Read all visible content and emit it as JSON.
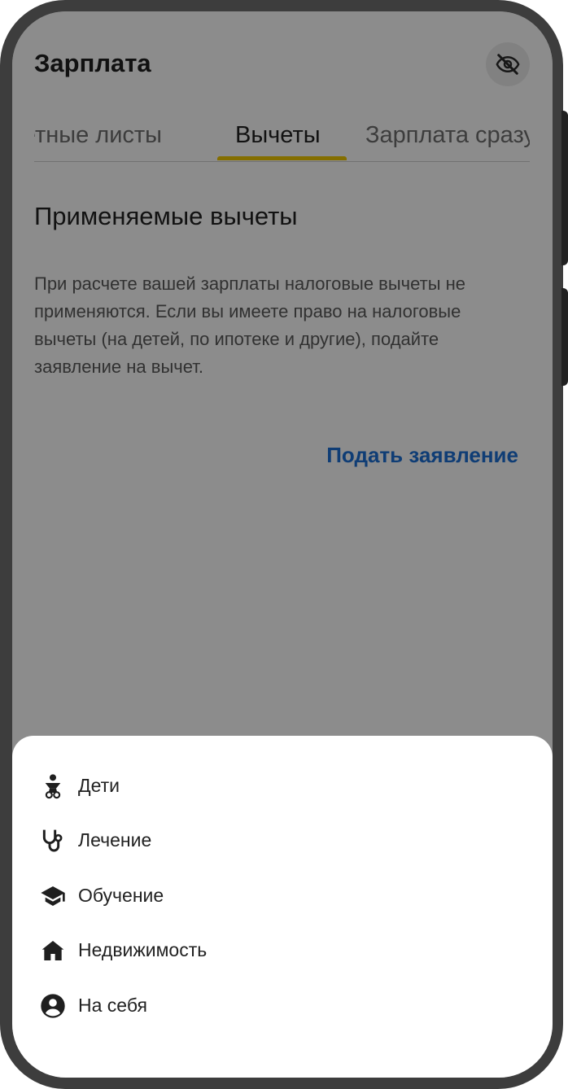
{
  "header": {
    "title": "Зарплата",
    "hide_icon": "eye-off-icon"
  },
  "tabs": [
    {
      "label": "Расчетные листы"
    },
    {
      "label": "Вычеты",
      "active": true
    },
    {
      "label": "Зарплата сразу"
    }
  ],
  "colors": {
    "accent_yellow": "#f0c800",
    "link_blue": "#1d6fd6"
  },
  "main": {
    "section_title": "Применяемые вычеты",
    "description": "При расчете вашей зарплаты налоговые вычеты не применяются. Если вы имеете право на налоговые вычеты (на детей, по ипотеке и другие), подайте заявление на вычет.",
    "apply_label": "Подать заявление"
  },
  "sheet": {
    "items": [
      {
        "label": "Дети",
        "icon": "baby-icon"
      },
      {
        "label": "Лечение",
        "icon": "stethoscope-icon"
      },
      {
        "label": "Обучение",
        "icon": "graduation-cap-icon"
      },
      {
        "label": "Недвижимость",
        "icon": "home-icon"
      },
      {
        "label": "На себя",
        "icon": "account-circle-icon"
      }
    ]
  }
}
